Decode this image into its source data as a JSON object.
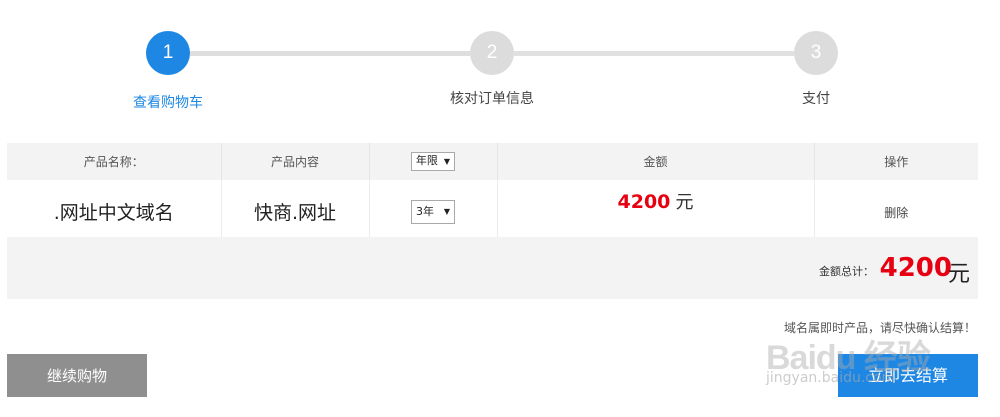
{
  "stepper": {
    "steps": [
      {
        "num": "1",
        "label": "查看购物车"
      },
      {
        "num": "2",
        "label": "核对订单信息"
      },
      {
        "num": "3",
        "label": "支付"
      }
    ]
  },
  "table": {
    "headers": {
      "name": "产品名称：",
      "content": "产品内容",
      "period": "年限",
      "amount": "金额",
      "action": "操作"
    },
    "rows": [
      {
        "name": ".网址中文域名",
        "content": "快商.网址",
        "period": "3年",
        "amount": "4200",
        "unit": "元",
        "action": "删除"
      }
    ]
  },
  "total": {
    "label": "金额总计：",
    "value": "4200",
    "unit": "元"
  },
  "notice": "域名属即时产品，请尽快确认结算！",
  "buttons": {
    "continue": "继续购物",
    "checkout": "立即去结算"
  },
  "watermark": {
    "brand": "Baidu 经验",
    "sub": "jingyan.baidu.com"
  },
  "colors": {
    "accent": "#1e87e4",
    "price": "#e60012",
    "inactive_step": "#dcdcdc",
    "continue_button": "#8f8f8f"
  }
}
